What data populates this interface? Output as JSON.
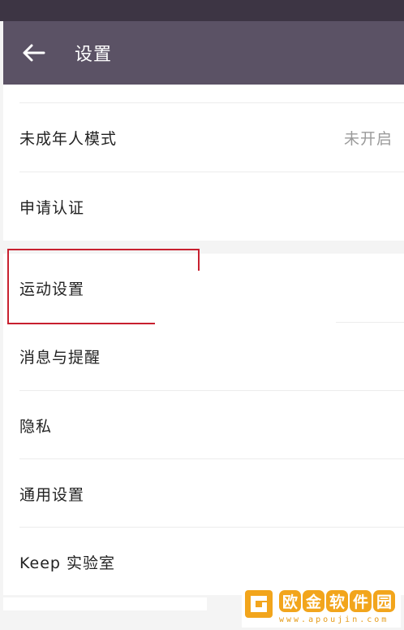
{
  "header": {
    "title": "设置"
  },
  "section1": {
    "items": [
      {
        "label": "未成年人模式",
        "value": "未开启"
      },
      {
        "label": "申请认证"
      }
    ]
  },
  "section2": {
    "items": [
      {
        "label": "运动设置"
      },
      {
        "label": "消息与提醒"
      },
      {
        "label": "隐私"
      },
      {
        "label": "通用设置"
      },
      {
        "label": "Keep 实验室"
      }
    ]
  },
  "watermark": {
    "chars": [
      "欧",
      "金",
      "软",
      "件",
      "园"
    ],
    "url": "www.apoujin.com"
  },
  "colors": {
    "statusbar": "#3d3544",
    "appbar": "#5b5265",
    "highlight": "#c8202f",
    "watermark_accent": "#f2a51c"
  }
}
